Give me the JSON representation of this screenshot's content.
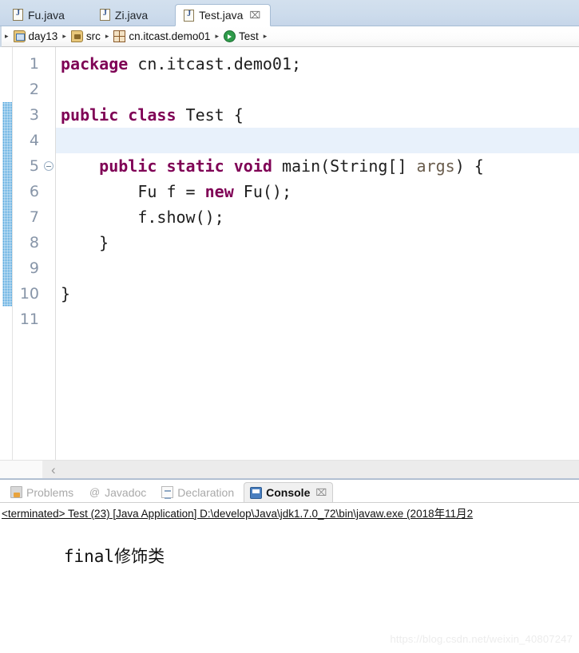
{
  "editor_tabs": [
    {
      "label": "Fu.java",
      "icon": "java-file-icon",
      "active": false,
      "closable": false
    },
    {
      "label": "Zi.java",
      "icon": "java-file-icon",
      "active": false,
      "closable": false
    },
    {
      "label": "Test.java",
      "icon": "java-file-icon",
      "active": true,
      "closable": true,
      "close_glyph": "⌧"
    }
  ],
  "breadcrumb": {
    "leading_arrow": "▸",
    "separator": "▸",
    "items": [
      {
        "label": "day13",
        "icon": "java-project-icon"
      },
      {
        "label": "src",
        "icon": "source-folder-icon"
      },
      {
        "label": "cn.itcast.demo01",
        "icon": "package-icon"
      },
      {
        "label": "Test",
        "icon": "java-class-icon"
      }
    ],
    "trailing_arrow": "▸"
  },
  "editor": {
    "current_line": 4,
    "change_bar_from_line": 3,
    "change_bar_to_line": 10,
    "change_bar_color": "#3a9ad9",
    "keyword_color": "#7f0055",
    "current_line_highlight": "#e8f1fb",
    "lines": [
      {
        "num": "1",
        "fold": false,
        "current": false,
        "tokens": [
          {
            "t": "package",
            "c": "kw"
          },
          {
            "t": " cn.itcast.demo01;",
            "c": "plain"
          }
        ]
      },
      {
        "num": "2",
        "fold": false,
        "current": false,
        "tokens": []
      },
      {
        "num": "3",
        "fold": false,
        "current": false,
        "tokens": [
          {
            "t": "public class",
            "c": "kw"
          },
          {
            "t": " Test {",
            "c": "plain"
          }
        ]
      },
      {
        "num": "4",
        "fold": false,
        "current": true,
        "tokens": []
      },
      {
        "num": "5",
        "fold": true,
        "current": false,
        "tokens": [
          {
            "t": "    ",
            "c": "plain"
          },
          {
            "t": "public static void",
            "c": "kw"
          },
          {
            "t": " main(String[] ",
            "c": "plain"
          },
          {
            "t": "args",
            "c": "param"
          },
          {
            "t": ") {",
            "c": "plain"
          }
        ]
      },
      {
        "num": "6",
        "fold": false,
        "current": false,
        "tokens": [
          {
            "t": "        Fu f = ",
            "c": "plain"
          },
          {
            "t": "new",
            "c": "kw"
          },
          {
            "t": " Fu();",
            "c": "plain"
          }
        ]
      },
      {
        "num": "7",
        "fold": false,
        "current": false,
        "tokens": [
          {
            "t": "        f.show();",
            "c": "plain"
          }
        ]
      },
      {
        "num": "8",
        "fold": false,
        "current": false,
        "tokens": [
          {
            "t": "    }",
            "c": "plain"
          }
        ]
      },
      {
        "num": "9",
        "fold": false,
        "current": false,
        "tokens": []
      },
      {
        "num": "10",
        "fold": false,
        "current": false,
        "tokens": [
          {
            "t": "}",
            "c": "plain"
          }
        ]
      },
      {
        "num": "11",
        "fold": false,
        "current": false,
        "tokens": []
      }
    ],
    "h_scroll_left_arrow": "‹"
  },
  "console_panel": {
    "tabs": [
      {
        "label": "Problems",
        "icon": "problems-icon",
        "active": false,
        "closable": false
      },
      {
        "label": "Javadoc",
        "icon": "javadoc-icon",
        "active": false,
        "closable": false,
        "glyph": "@"
      },
      {
        "label": "Declaration",
        "icon": "declaration-icon",
        "active": false,
        "closable": false
      },
      {
        "label": "Console",
        "icon": "console-icon",
        "active": true,
        "closable": true,
        "close_glyph": "⌧"
      }
    ],
    "status_line": "<terminated> Test (23) [Java Application] D:\\develop\\Java\\jdk1.7.0_72\\bin\\javaw.exe (2018年11月2",
    "output": "final修饰类"
  },
  "watermark": "https://blog.csdn.net/weixin_40807247"
}
